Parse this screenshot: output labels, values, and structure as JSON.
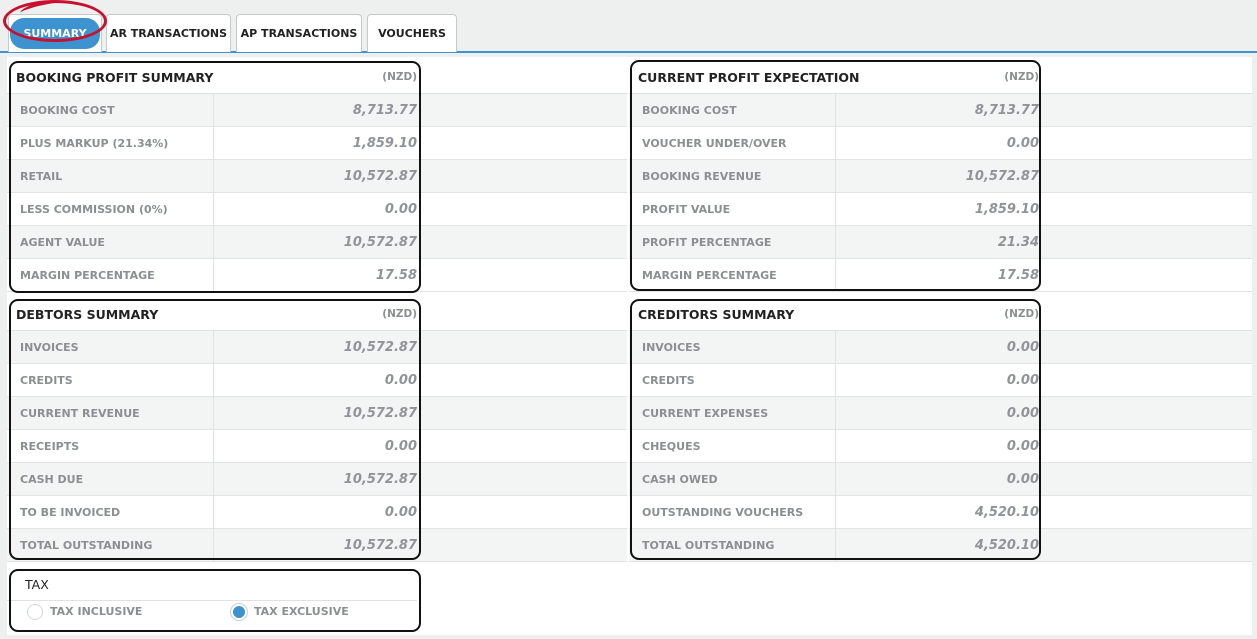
{
  "tabs": [
    {
      "label": "SUMMARY",
      "active": true
    },
    {
      "label": "AR TRANSACTIONS"
    },
    {
      "label": "AP TRANSACTIONS"
    },
    {
      "label": "VOUCHERS"
    }
  ],
  "booking_profit": {
    "title": "BOOKING PROFIT SUMMARY",
    "currency": "(NZD)",
    "rows": [
      {
        "label": "BOOKING COST",
        "value": "8,713.77"
      },
      {
        "label": "PLUS MARKUP (21.34%)",
        "value": "1,859.10"
      },
      {
        "label": "RETAIL",
        "value": "10,572.87"
      },
      {
        "label": "LESS COMMISSION (0%)",
        "value": "0.00"
      },
      {
        "label": "AGENT VALUE",
        "value": "10,572.87"
      },
      {
        "label": "MARGIN PERCENTAGE",
        "value": "17.58"
      }
    ]
  },
  "current_profit": {
    "title": "CURRENT PROFIT EXPECTATION",
    "currency": "(NZD)",
    "rows": [
      {
        "label": "BOOKING COST",
        "value": "8,713.77"
      },
      {
        "label": "VOUCHER UNDER/OVER",
        "value": "0.00"
      },
      {
        "label": "BOOKING REVENUE",
        "value": "10,572.87"
      },
      {
        "label": "PROFIT VALUE",
        "value": "1,859.10"
      },
      {
        "label": "PROFIT PERCENTAGE",
        "value": "21.34"
      },
      {
        "label": "MARGIN PERCENTAGE",
        "value": "17.58"
      }
    ]
  },
  "debtors": {
    "title": "DEBTORS SUMMARY",
    "currency": "(NZD)",
    "rows": [
      {
        "label": "INVOICES",
        "value": "10,572.87"
      },
      {
        "label": "CREDITS",
        "value": "0.00"
      },
      {
        "label": "CURRENT REVENUE",
        "value": "10,572.87"
      },
      {
        "label": "RECEIPTS",
        "value": "0.00"
      },
      {
        "label": "CASH DUE",
        "value": "10,572.87"
      },
      {
        "label": "TO BE INVOICED",
        "value": "0.00"
      },
      {
        "label": "TOTAL OUTSTANDING",
        "value": "10,572.87"
      }
    ]
  },
  "creditors": {
    "title": "CREDITORS SUMMARY",
    "currency": "(NZD)",
    "rows": [
      {
        "label": "INVOICES",
        "value": "0.00"
      },
      {
        "label": "CREDITS",
        "value": "0.00"
      },
      {
        "label": "CURRENT EXPENSES",
        "value": "0.00"
      },
      {
        "label": "CHEQUES",
        "value": "0.00"
      },
      {
        "label": "CASH OWED",
        "value": "0.00"
      },
      {
        "label": "OUTSTANDING VOUCHERS",
        "value": "4,520.10"
      },
      {
        "label": "TOTAL OUTSTANDING",
        "value": "4,520.10"
      }
    ]
  },
  "tax": {
    "title": "TAX",
    "options": [
      {
        "label": "TAX INCLUSIVE",
        "selected": false
      },
      {
        "label": "TAX EXCLUSIVE",
        "selected": true
      }
    ]
  },
  "colors": {
    "accent": "#3d92d0",
    "annotation_red": "#c8102e"
  }
}
